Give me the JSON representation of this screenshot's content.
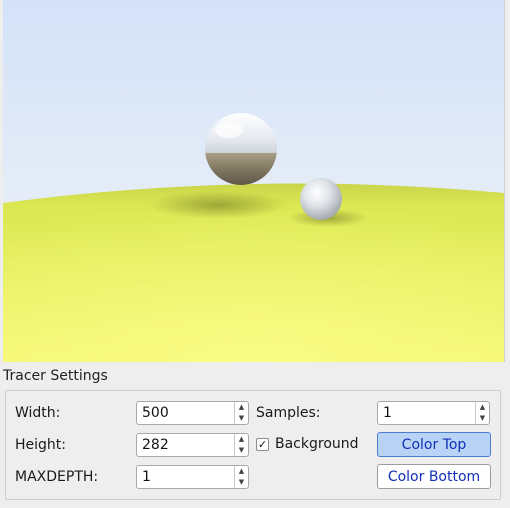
{
  "render": {
    "sky_top": "#d6e4fa",
    "sky_bottom": "#eef3f8",
    "ground_color": "#e5f266"
  },
  "settings": {
    "group_title": "Tracer Settings",
    "width_label": "Width:",
    "width_value": "500",
    "height_label": "Height:",
    "height_value": "282",
    "maxdepth_label": "MAXDEPTH:",
    "maxdepth_value": "1",
    "samples_label": "Samples:",
    "samples_value": "1",
    "background_label": "Background",
    "background_checked": "✓",
    "color_top_label": "Color Top",
    "color_bottom_label": "Color Bottom"
  },
  "icons": {
    "spin_up": "▲",
    "spin_down": "▼"
  }
}
